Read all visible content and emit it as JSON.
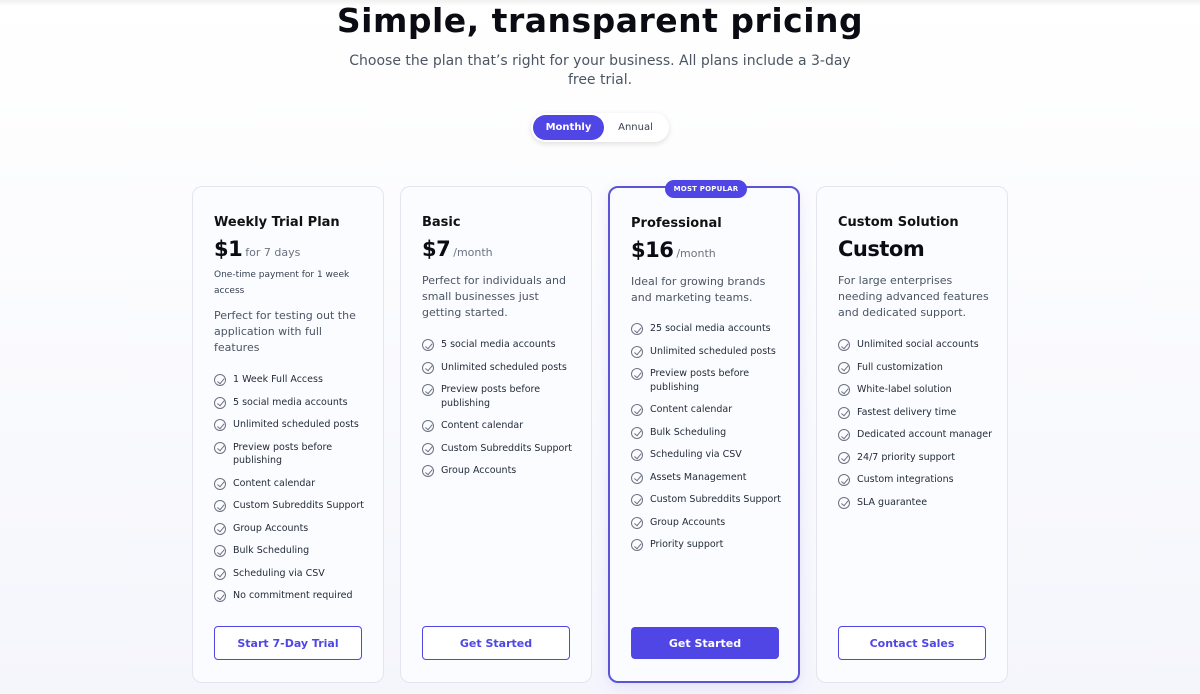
{
  "header": {
    "title": "Simple, transparent pricing",
    "subtitle": "Choose the plan that’s right for your business. All plans include a 3-day free trial."
  },
  "billing_toggle": {
    "selected": "Monthly",
    "options": [
      "Monthly",
      "Annual"
    ]
  },
  "colors": {
    "accent": "#4f46e5",
    "text": "#111827",
    "muted": "#4b5563"
  },
  "plans": [
    {
      "name": "Weekly Trial Plan",
      "price": "$1",
      "period": "for 7 days",
      "note": "One-time payment for 1 week access",
      "description": "Perfect for testing out the application with full features",
      "features": [
        "1 Week Full Access",
        "5 social media accounts",
        "Unlimited scheduled posts",
        "Preview posts before publishing",
        "Content calendar",
        "Custom Subreddits Support",
        "Group Accounts",
        "Bulk Scheduling",
        "Scheduling via CSV",
        "No commitment required"
      ],
      "cta": "Start 7-Day Trial"
    },
    {
      "name": "Basic",
      "price": "$7",
      "period": "/month",
      "description": "Perfect for individuals and small businesses just getting started.",
      "features": [
        "5 social media accounts",
        "Unlimited scheduled posts",
        "Preview posts before publishing",
        "Content calendar",
        "Custom Subreddits Support",
        "Group Accounts"
      ],
      "cta": "Get Started"
    },
    {
      "name": "Professional",
      "badge": "MOST POPULAR",
      "price": "$16",
      "period": "/month",
      "description": "Ideal for growing brands and marketing teams.",
      "features": [
        "25 social media accounts",
        "Unlimited scheduled posts",
        "Preview posts before publishing",
        "Content calendar",
        "Bulk Scheduling",
        "Scheduling via CSV",
        "Assets Management",
        "Custom Subreddits Support",
        "Group Accounts",
        "Priority support"
      ],
      "cta": "Get Started"
    },
    {
      "name": "Custom Solution",
      "price": "Custom",
      "description": "For large enterprises needing advanced features and dedicated support.",
      "features": [
        "Unlimited social accounts",
        "Full customization",
        "White-label solution",
        "Fastest delivery time",
        "Dedicated account manager",
        "24/7 priority support",
        "Custom integrations",
        "SLA guarantee"
      ],
      "cta": "Contact Sales"
    }
  ]
}
